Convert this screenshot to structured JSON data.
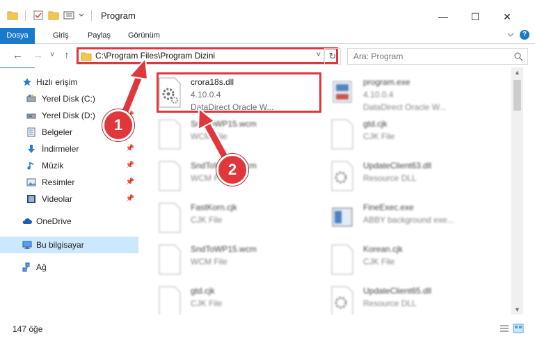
{
  "window": {
    "title": "Program",
    "minimize": "—",
    "maximize": "☐",
    "close": "✕"
  },
  "ribbon": {
    "tabs": [
      "Dosya",
      "Giriş",
      "Paylaş",
      "Görünüm"
    ],
    "expand_icon": "chevron-down-icon",
    "help": "?"
  },
  "nav": {
    "back": "←",
    "forward": "→",
    "recent": "˅",
    "up": "↑",
    "path": "C:\\Program Files\\Program Dizini",
    "dropdown": "˅",
    "refresh": "↻",
    "search_placeholder": "Ara: Program"
  },
  "sidebar": {
    "items": [
      {
        "label": "Hızlı erişim",
        "icon": "star-icon",
        "pinned": false
      },
      {
        "label": "Yerel Disk (C:)",
        "icon": "drive-icon",
        "pinned": true
      },
      {
        "label": "Yerel Disk (D:)",
        "icon": "drive-icon",
        "pinned": true
      },
      {
        "label": "Belgeler",
        "icon": "documents-icon",
        "pinned": true
      },
      {
        "label": "İndirmeler",
        "icon": "download-icon",
        "pinned": true
      },
      {
        "label": "Müzik",
        "icon": "music-icon",
        "pinned": true
      },
      {
        "label": "Resimler",
        "icon": "pictures-icon",
        "pinned": true
      },
      {
        "label": "Videolar",
        "icon": "video-icon",
        "pinned": true
      },
      {
        "label": "OneDrive",
        "icon": "cloud-icon",
        "pinned": false
      },
      {
        "label": "Bu bilgisayar",
        "icon": "computer-icon",
        "pinned": false
      },
      {
        "label": "Ağ",
        "icon": "network-icon",
        "pinned": false
      }
    ]
  },
  "files": [
    {
      "name": "crora18s.dll",
      "line1": "4.10.0.4",
      "line2": "DataDirect Oracle W...",
      "icon": "dll-gear-icon"
    },
    {
      "name": "program.exe",
      "line1": "4.10.0.4",
      "line2": "DataDirect Oracle W...",
      "icon": "exe-icon"
    },
    {
      "name": "SndToWP15.wcm",
      "line1": "WCM File",
      "line2": "",
      "icon": "file-icon"
    },
    {
      "name": "gtd.cjk",
      "line1": "CJK File",
      "line2": "",
      "icon": "file-icon"
    },
    {
      "name": "SndToWP15.wcm",
      "line1": "WCM File",
      "line2": "",
      "icon": "file-icon"
    },
    {
      "name": "UpdateClient63.dll",
      "line1": "Resource DLL",
      "line2": "",
      "icon": "dll-gear-icon"
    },
    {
      "name": "FastKorn.cjk",
      "line1": "CJK File",
      "line2": "",
      "icon": "file-icon"
    },
    {
      "name": "FineExec.exe",
      "line1": "ABBY background exe...",
      "line2": "",
      "icon": "exe-icon"
    },
    {
      "name": "SndToWP15.wcm",
      "line1": "WCM File",
      "line2": "",
      "icon": "file-icon"
    },
    {
      "name": "Korean.cjk",
      "line1": "CJK File",
      "line2": "",
      "icon": "file-icon"
    },
    {
      "name": "gtd.cjk",
      "line1": "CJK File",
      "line2": "",
      "icon": "file-icon"
    },
    {
      "name": "UpdateClient65.dll",
      "line1": "Resource DLL",
      "line2": "",
      "icon": "dll-gear-icon"
    }
  ],
  "status": {
    "count": "147 öğe"
  },
  "callouts": [
    "1",
    "2"
  ],
  "colors": {
    "accent": "#1979ca",
    "highlight": "#e0373c",
    "selected": "#cce8ff"
  }
}
